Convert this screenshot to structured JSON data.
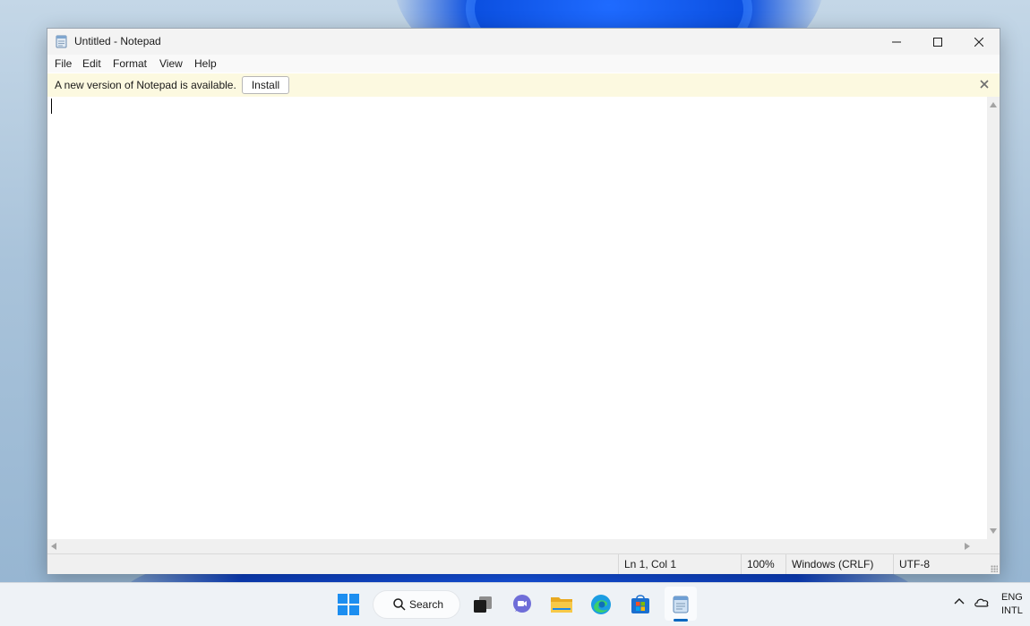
{
  "window": {
    "title": "Untitled - Notepad"
  },
  "menu": {
    "items": [
      "File",
      "Edit",
      "Format",
      "View",
      "Help"
    ]
  },
  "infobar": {
    "message": "A new version of Notepad is available.",
    "install_label": "Install"
  },
  "editor": {
    "text": ""
  },
  "status": {
    "position": "Ln 1, Col 1",
    "zoom": "100%",
    "line_ending": "Windows (CRLF)",
    "encoding": "UTF-8"
  },
  "taskbar": {
    "search_label": "Search",
    "apps": [
      "start-icon",
      "search-icon",
      "task-view-icon",
      "teams-chat-icon",
      "file-explorer-icon",
      "edge-icon",
      "store-icon",
      "notepad-icon"
    ],
    "tray": {
      "lang_line1": "ENG",
      "lang_line2": "INTL"
    }
  },
  "colors": {
    "infobar_bg": "#fcf9e0",
    "accent": "#0067c0",
    "titlebar_bg": "#f3f3f3"
  }
}
